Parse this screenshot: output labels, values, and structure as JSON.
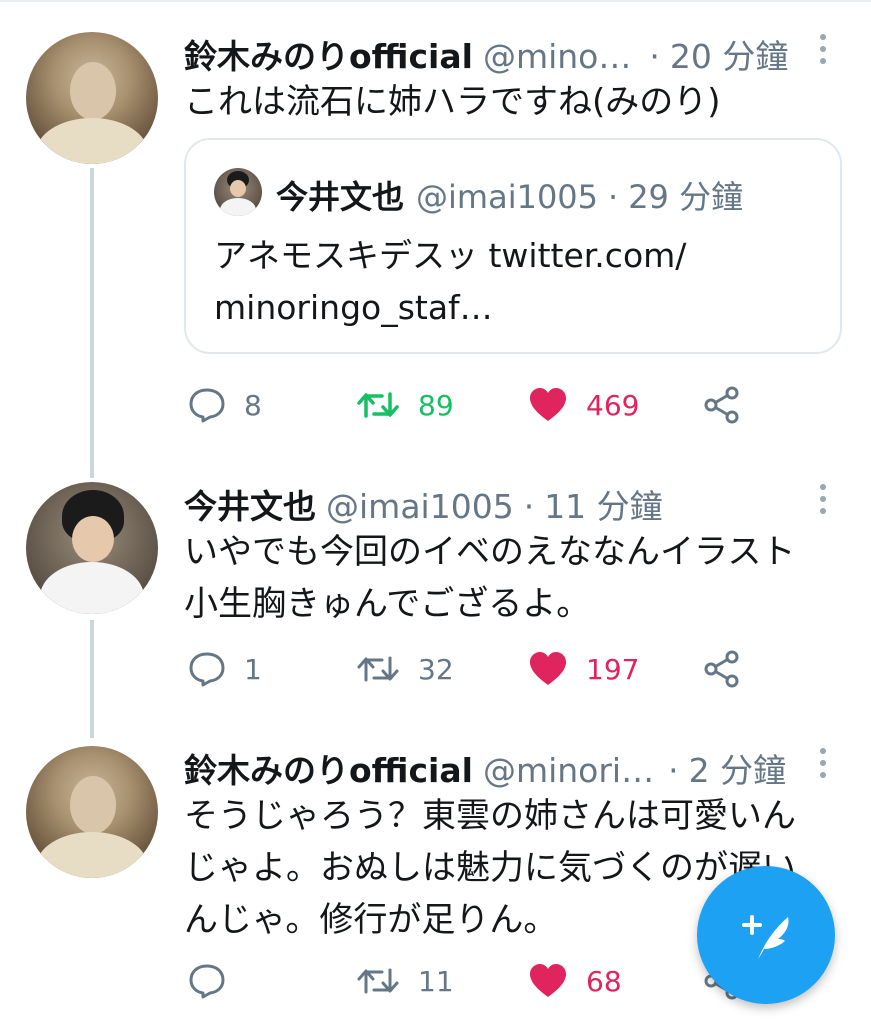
{
  "tweets": [
    {
      "author_name": "鈴木みのりofficial",
      "author_handle": "@mino…",
      "time": "20 分鐘",
      "text": "これは流石に姉ハラですね(みのり)",
      "quote": {
        "author_name": "今井文也",
        "author_handle": "@imai1005",
        "time": "29 分鐘",
        "text_line1": "アネモスキデスッ twitter.com/",
        "text_line2": "minoringo_staf…"
      },
      "replies": "8",
      "retweets": "89",
      "likes": "469",
      "retweeted": true,
      "liked": true
    },
    {
      "author_name": "今井文也",
      "author_handle": "@imai1005",
      "time": "11 分鐘",
      "text_line1": "いやでも今回のイベのえななんイラスト",
      "text_line2": "小生胸きゅんでござるよ。",
      "replies": "1",
      "retweets": "32",
      "likes": "197",
      "retweeted": false,
      "liked": true
    },
    {
      "author_name": "鈴木みのりofficial",
      "author_handle": "@minori…",
      "time": "2 分鐘",
      "text_line1": "そうじゃろう？東雲の姉さんは可愛いん",
      "text_line2": "じゃよ。おぬしは魅力に気づくのが遅い",
      "text_line3": "んじゃ。修行が足りん。",
      "replies": "",
      "retweets": "11",
      "likes": "68",
      "retweeted": false,
      "liked": true
    }
  ],
  "colors": {
    "accent": "#1da1f2",
    "like": "#e0245e",
    "retweet": "#17bf63",
    "muted": "#657786"
  },
  "icons": {
    "reply": "reply-icon",
    "retweet": "retweet-icon",
    "like": "heart-icon",
    "share": "share-icon",
    "more": "more-vertical-icon",
    "compose": "compose-tweet-icon"
  }
}
